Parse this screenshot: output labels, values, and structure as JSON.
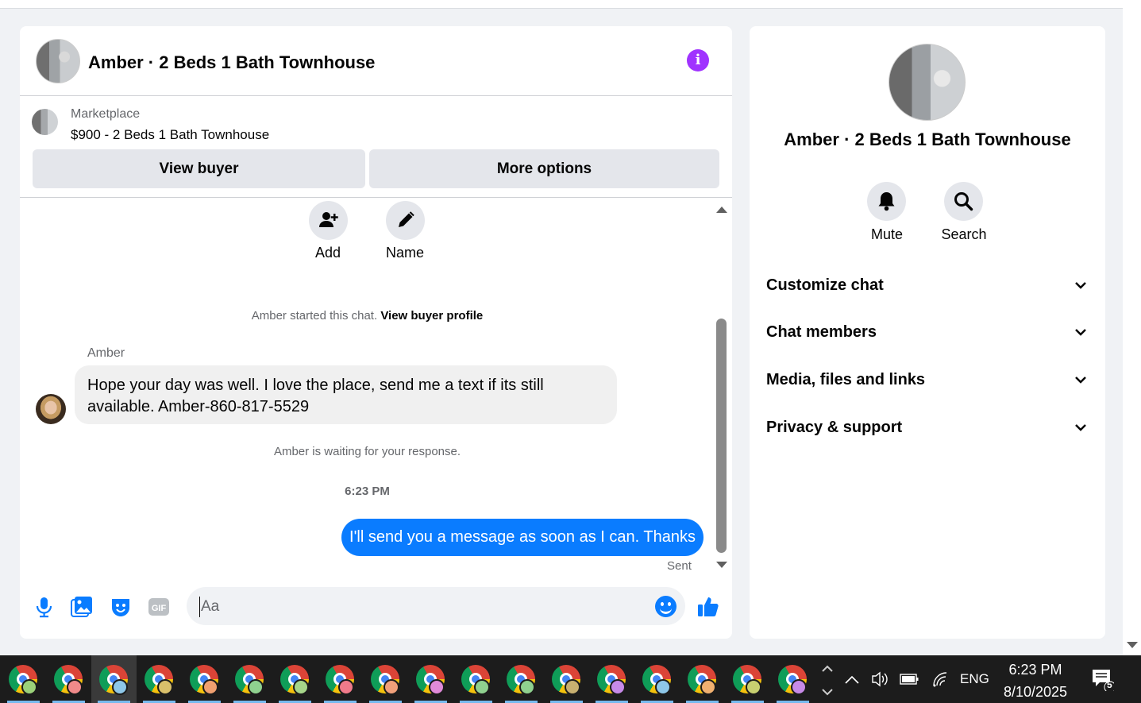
{
  "chat": {
    "title": "Amber · 2 Beds 1 Bath Townhouse",
    "marketplace_label": "Marketplace",
    "listing": "$900 - 2 Beds 1 Bath Townhouse",
    "view_buyer": "View buyer",
    "more_options": "More options",
    "add_label": "Add",
    "name_label": "Name",
    "started_text": "Amber started this chat.",
    "view_buyer_profile": "View buyer profile",
    "sender": "Amber",
    "incoming_message": "Hope your day was well. I love the place, send me a text if its still available. Amber-860-817-5529",
    "waiting_text": "Amber is waiting for your response.",
    "timestamp": "6:23 PM",
    "outgoing_message": "I'll send you a message as soon as I can. Thanks",
    "status": "Sent",
    "input_placeholder": "Aa",
    "accent": "#0a7cff",
    "info_color": "#a033ff"
  },
  "info": {
    "title": "Amber · 2 Beds 1 Bath Townhouse",
    "mute": "Mute",
    "search": "Search",
    "sections": [
      {
        "label": "Customize chat"
      },
      {
        "label": "Chat members"
      },
      {
        "label": "Media, files and links"
      },
      {
        "label": "Privacy & support"
      }
    ]
  },
  "taskbar": {
    "app_icon": "chrome-icon",
    "badge_colors": [
      "#9bd17a",
      "#f08a8a",
      "#8ec7e8",
      "#d9c06b",
      "#f0a070",
      "#8fd18f",
      "#a6d68a",
      "#f07a8a",
      "#f0a07a",
      "#e08ad9",
      "#8fd18f",
      "#8fd18f",
      "#c8b070",
      "#c78ae8",
      "#8ec7e8",
      "#f0b070",
      "#c8d070",
      "#c78ae8"
    ],
    "language": "ENG",
    "time": "6:23 PM",
    "date": "8/10/2025",
    "notification_count": "5"
  }
}
